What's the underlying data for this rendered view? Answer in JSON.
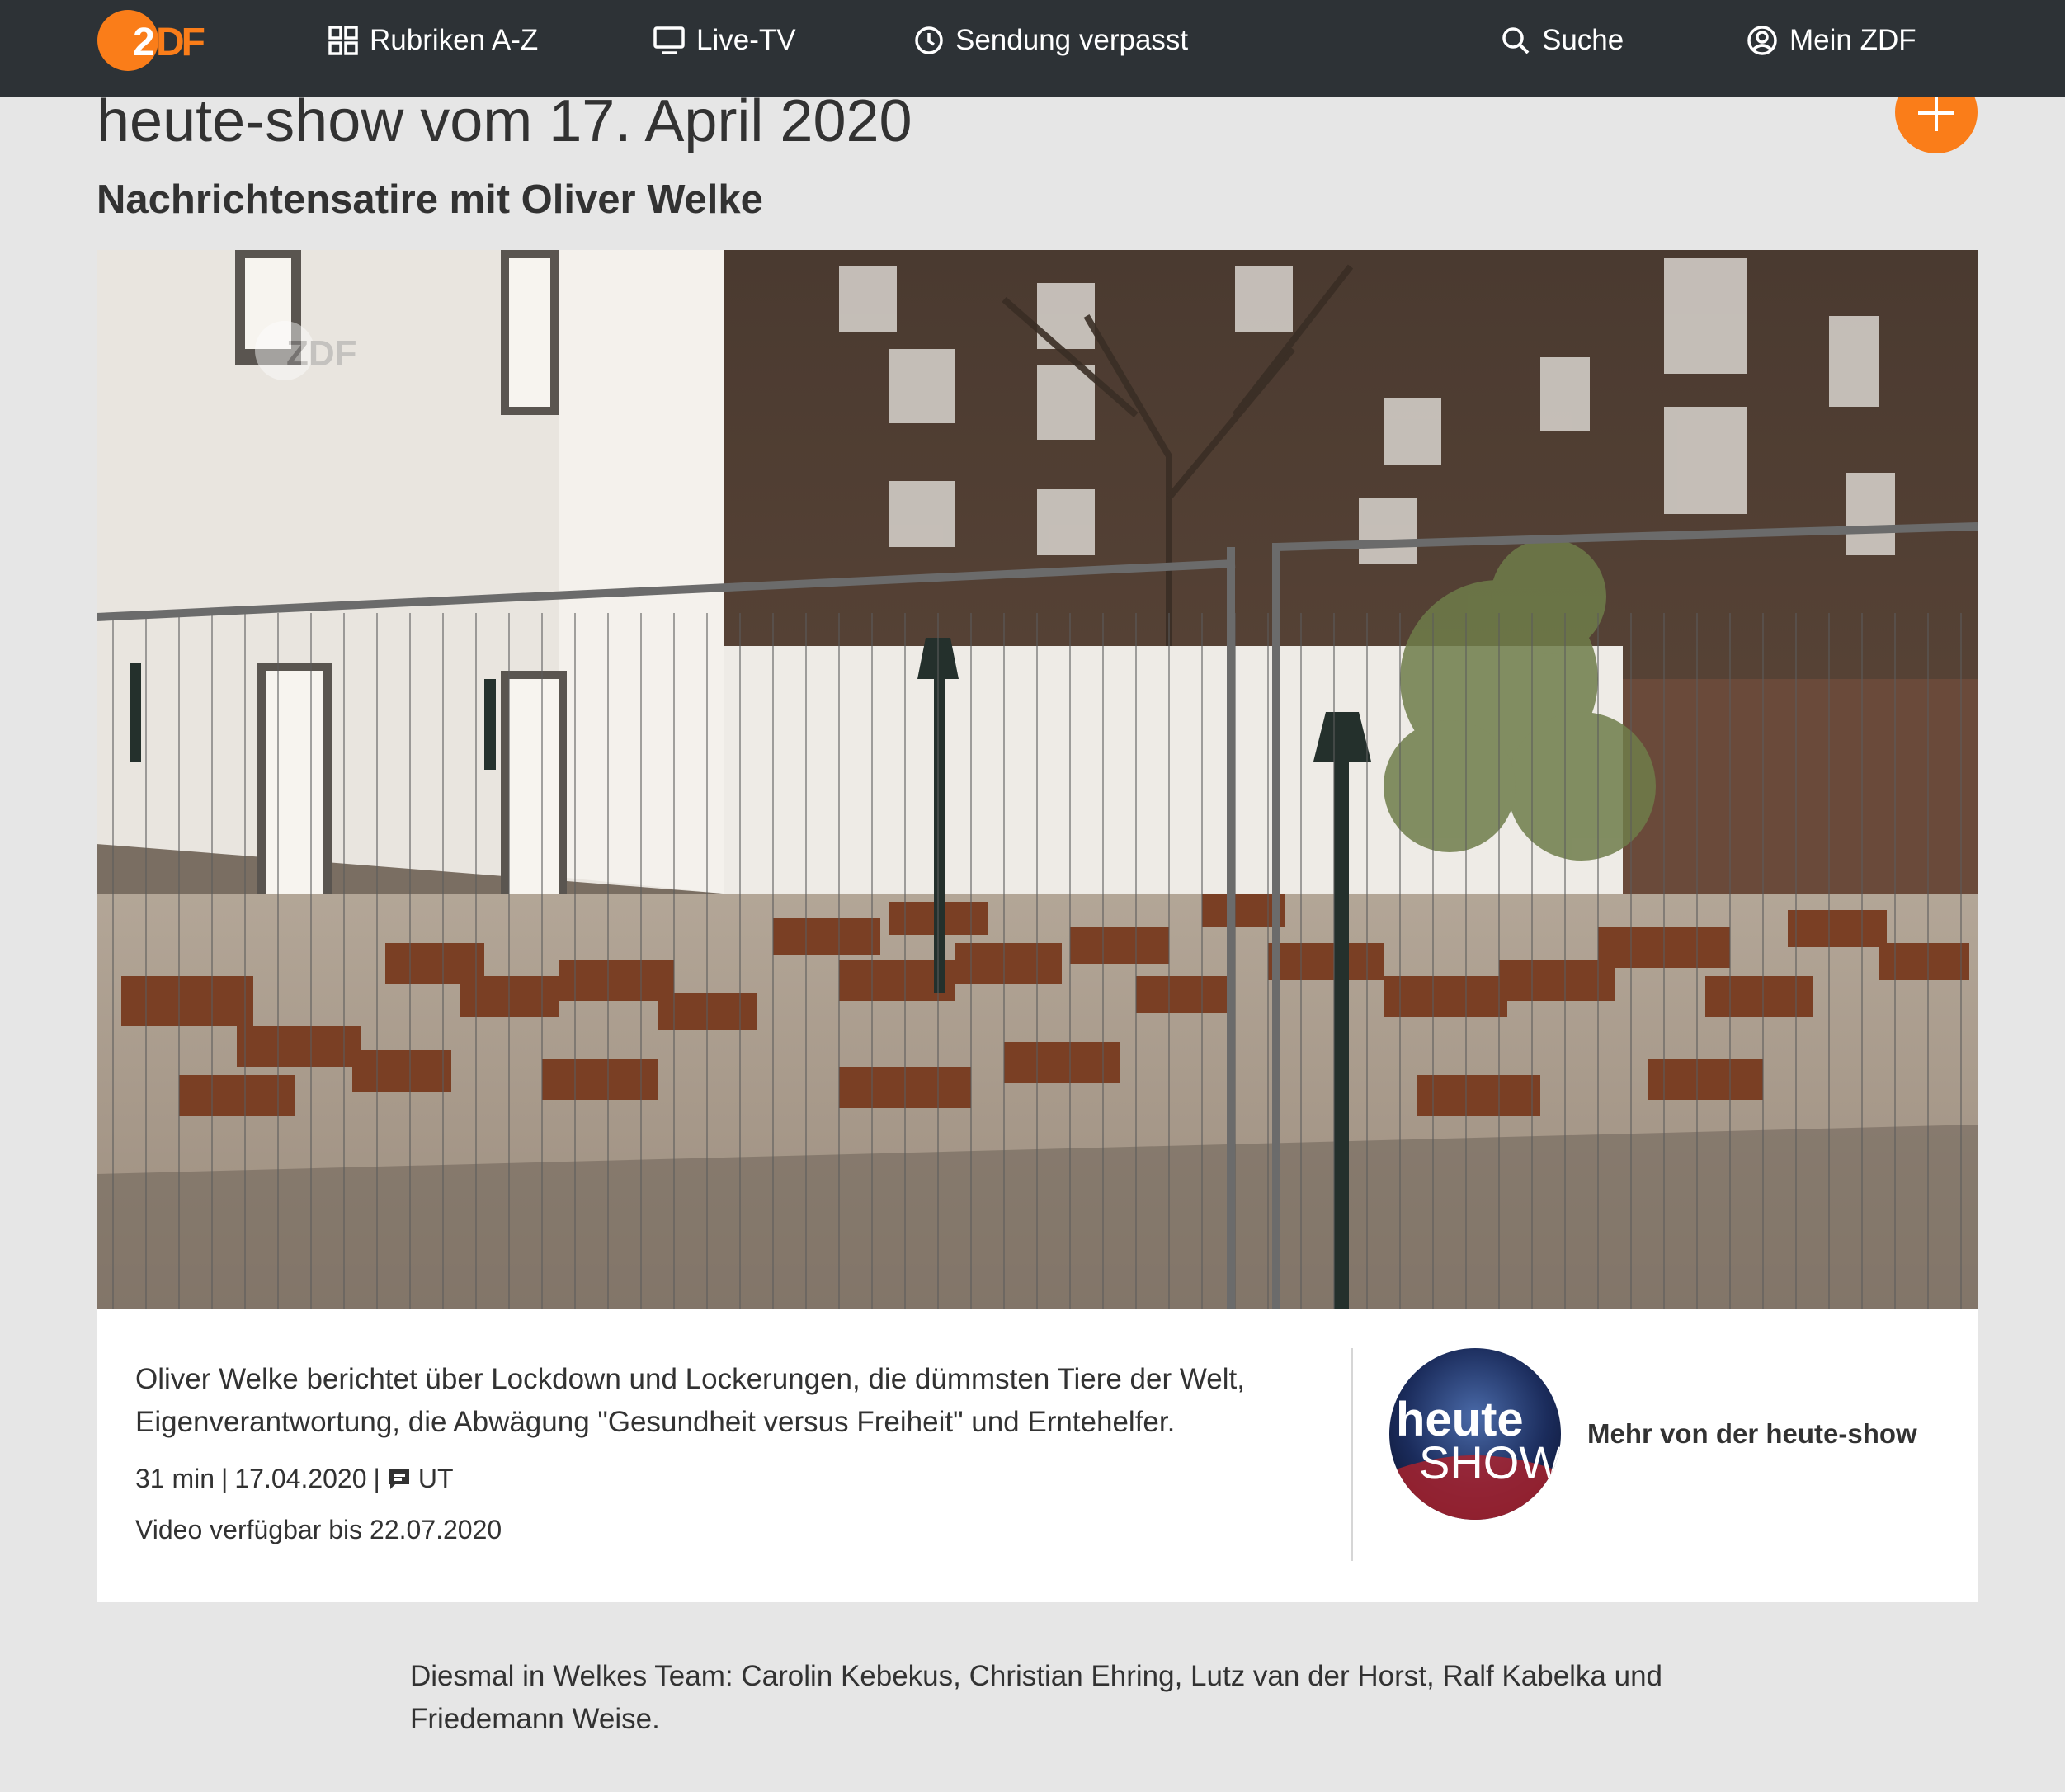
{
  "nav": {
    "brand": "ZDF",
    "brand_color": "#fa7d19",
    "bar_color": "#2d3236",
    "items": [
      {
        "label": "Rubriken A-Z",
        "icon": "grid-icon"
      },
      {
        "label": "Live-TV",
        "icon": "tv-icon"
      },
      {
        "label": "Sendung verpasst",
        "icon": "clock-icon"
      },
      {
        "label": "Suche",
        "icon": "search-icon"
      },
      {
        "label": "Mein ZDF",
        "icon": "user-icon"
      }
    ]
  },
  "page": {
    "title": "heute-show vom 17. April 2020",
    "subtitle": "Nachrichtensatire mit Oliver Welke",
    "add_icon": "plus-icon"
  },
  "video": {
    "watermark": "ZDF",
    "scene": "empty beer garden behind construction fence"
  },
  "info": {
    "description": "Oliver Welke berichtet über Lockdown und Lockerungen, die dümmsten Tiere der Welt, Eigenverantwortung, die Abwägung \"Gesundheit versus Freiheit\" und Erntehelfer.",
    "duration": "31 min",
    "separator": "|",
    "date": "17.04.2020",
    "subtitles": "UT",
    "availability": "Video verfügbar bis 22.07.2020"
  },
  "show": {
    "logo_line1": "heute",
    "logo_line2": "SHOW",
    "link_label": "Mehr von der heute-show"
  },
  "team": {
    "text": "Diesmal in Welkes Team: Carolin Kebekus, Christian Ehring, Lutz van der Horst, Ralf Kabelka und Friedemann Weise."
  }
}
